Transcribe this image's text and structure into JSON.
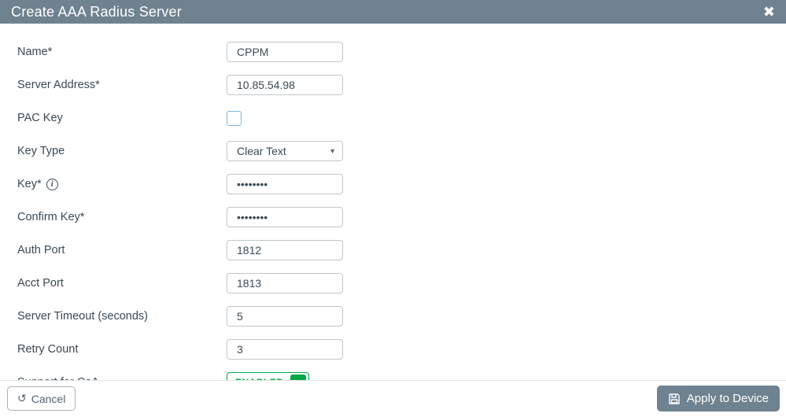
{
  "modal": {
    "title": "Create AAA Radius Server"
  },
  "fields": {
    "name": {
      "label": "Name*",
      "value": "CPPM"
    },
    "server_address": {
      "label": "Server Address*",
      "value": "10.85.54.98"
    },
    "pac_key": {
      "label": "PAC Key",
      "checked": false
    },
    "key_type": {
      "label": "Key Type",
      "selected": "Clear Text"
    },
    "key": {
      "label": "Key*",
      "value": "••••••••"
    },
    "confirm_key": {
      "label": "Confirm Key*",
      "value": "••••••••"
    },
    "auth_port": {
      "label": "Auth Port",
      "value": "1812"
    },
    "acct_port": {
      "label": "Acct Port",
      "value": "1813"
    },
    "server_timeout": {
      "label": "Server Timeout (seconds)",
      "value": "5"
    },
    "retry_count": {
      "label": "Retry Count",
      "value": "3"
    },
    "support_coa": {
      "label": "Support for CoA",
      "toggle_label": "ENABLED",
      "enabled": true
    }
  },
  "buttons": {
    "cancel": "Cancel",
    "apply": "Apply to Device"
  },
  "colors": {
    "header_bg": "#6e8290",
    "enabled_green": "#00a846",
    "text": "#3a4a55"
  }
}
